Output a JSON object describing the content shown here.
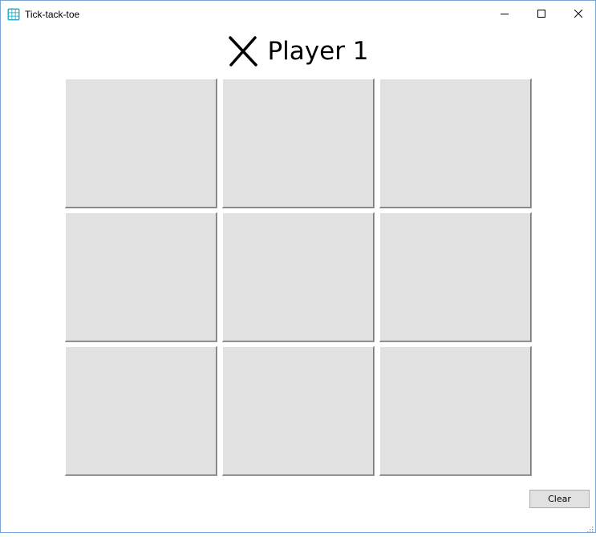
{
  "window": {
    "title": "Tick-tack-toe",
    "icon": "tic-tac-toe-grid-icon",
    "controls": [
      "minimize-icon",
      "maximize-icon",
      "close-icon"
    ]
  },
  "status": {
    "mark_icon": "x-mark-icon",
    "text": "Player 1"
  },
  "board": {
    "rows": 3,
    "cols": 3,
    "cells": [
      "",
      "",
      "",
      "",
      "",
      "",
      "",
      "",
      ""
    ]
  },
  "actions": {
    "clear_label": "Clear"
  },
  "colors": {
    "cell_face": "#e1e1e1",
    "window_border": "#7aa6d6",
    "app_icon": "#2ab0c6"
  }
}
